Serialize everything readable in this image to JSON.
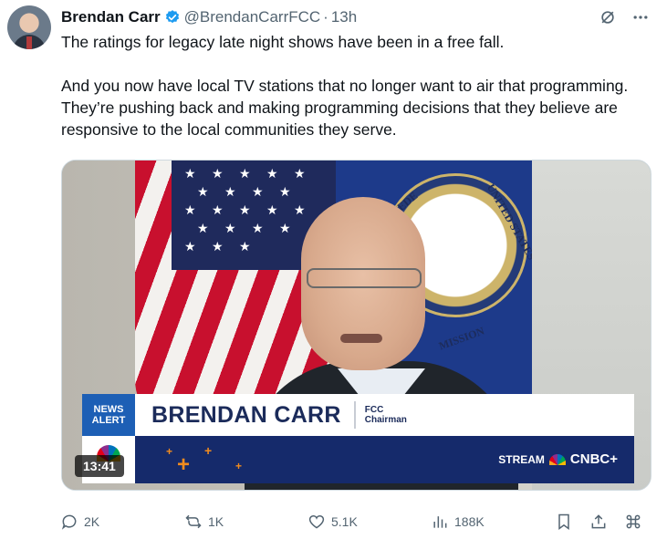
{
  "author": {
    "name": "Brendan Carr",
    "handle": "@BrendanCarrFCC",
    "separator": "·",
    "time": "13h",
    "avatar_icon": "user-avatar"
  },
  "tweet": {
    "paragraphs": [
      "The ratings for legacy late night shows have been in a free fall.",
      "And you now have local TV stations that no longer want to air that programming.  They’re pushing back and making programming decisions that they believe are responsive to the local communities they serve."
    ]
  },
  "video": {
    "duration": "13:41",
    "lower_third": {
      "badge_line1": "NEWS",
      "badge_line2": "ALERT",
      "name": "BRENDAN CARR",
      "title_line1": "FCC",
      "title_line2": "Chairman"
    },
    "stream_label": "STREAM",
    "network": "CNBC+",
    "seal_text_1": "UNITED STATES",
    "seal_text_2": "MISSION",
    "seal_text_3": "FEDE"
  },
  "actions": {
    "replies": "2K",
    "reposts": "1K",
    "likes": "5.1K",
    "views": "188K"
  },
  "colors": {
    "verified": "#1d9bf0",
    "muted_text": "#536471",
    "news_alert_blue": "#1d5fb5",
    "lower_third_navy": "#152a6b"
  },
  "icons": [
    "verified-badge-icon",
    "grok-icon",
    "more-icon",
    "reply-icon",
    "repost-icon",
    "like-icon",
    "views-icon",
    "bookmark-icon",
    "share-icon"
  ]
}
